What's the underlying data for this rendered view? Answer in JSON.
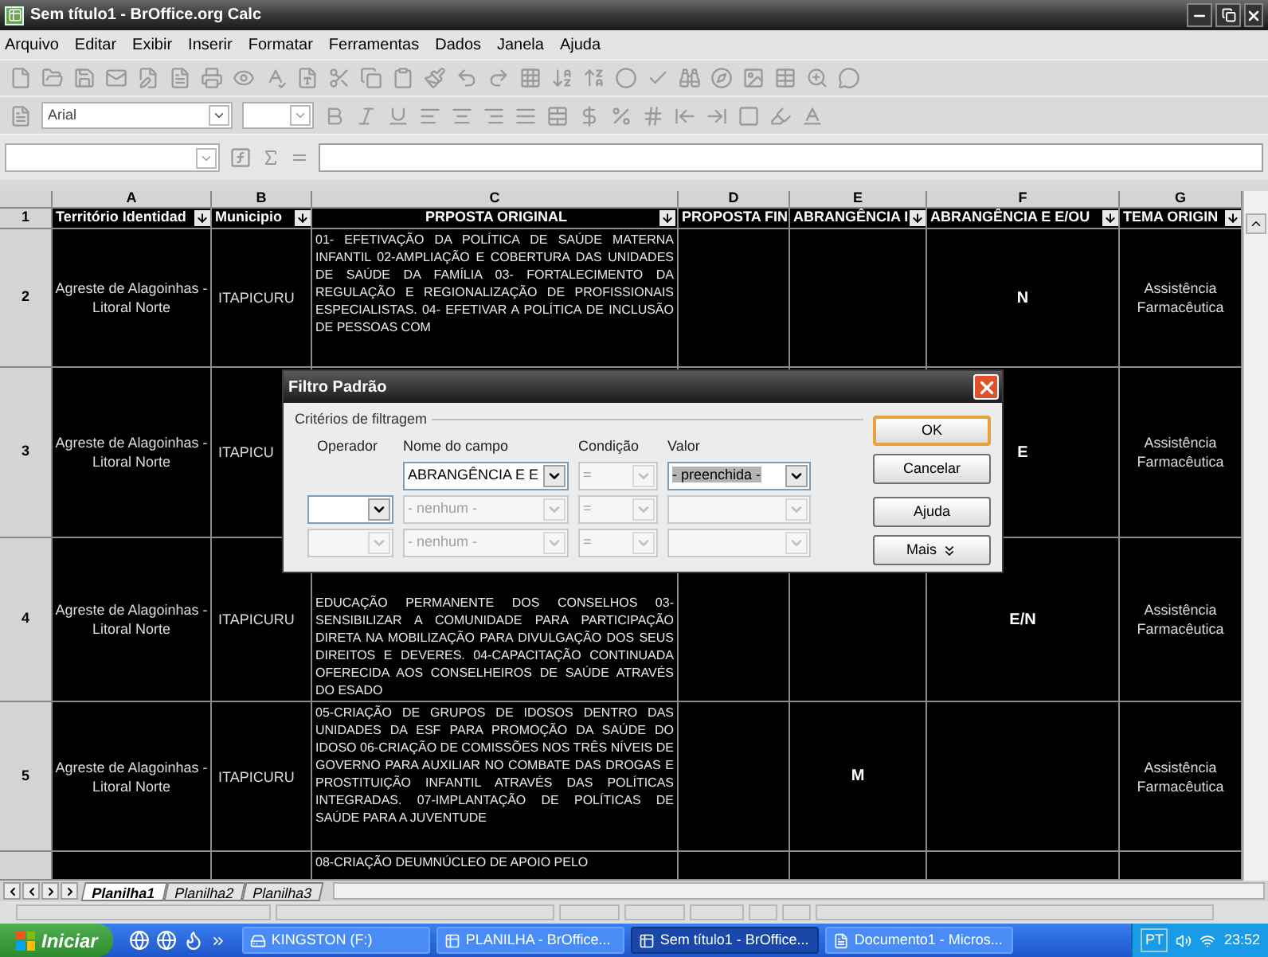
{
  "window": {
    "title": "Sem título1 - BrOffice.org Calc"
  },
  "menu": [
    "Arquivo",
    "Editar",
    "Exibir",
    "Inserir",
    "Formatar",
    "Ferramentas",
    "Dados",
    "Janela",
    "Ajuda"
  ],
  "font_name": {
    "value": "Arial"
  },
  "sheet": {
    "column_headers": [
      "A",
      "B",
      "C",
      "D",
      "E",
      "F",
      "G"
    ],
    "header_row": {
      "number": "1",
      "cells": [
        "Território Identidad",
        "Municipio",
        "PRPOSTA ORIGINAL",
        "PROPOSTA FIN",
        "ABRANGÊNCIA I",
        "ABRANGÊNCIA E E/OU",
        "TEMA ORIGIN"
      ]
    },
    "rows": [
      {
        "number": "2",
        "territory": "Agreste de Alagoinhas - Litoral Norte",
        "municipality": "ITAPICURU",
        "original_proposal": "01- EFETIVAÇÃO DA POLÍTICA DE SAÚDE MATERNA INFANTIL 02-AMPLIAÇÃO E COBERTURA DAS UNIDADES DE SAÚDE DA FAMÍLIA 03- FORTALECIMENTO DA REGULAÇÃO E REGIONALIZAÇÃO DE PROFISSIONAIS ESPECIALISTAS. 04- EFETIVAR A POLÍTICA DE INCLUSÃO DE PESSOAS COM",
        "scope_f": "N",
        "original_theme": "Assistência Farmacêutica"
      },
      {
        "number": "3",
        "territory": "Agreste de Alagoinhas - Litoral Norte",
        "municipality": "ITAPICU",
        "scope_f": "E",
        "original_theme": "Assistência Farmacêutica"
      },
      {
        "number": "4",
        "territory": "Agreste de Alagoinhas - Litoral Norte",
        "municipality": "ITAPICURU",
        "original_proposal": "EDUCAÇÃO PERMANENTE DOS CONSELHOS 03-SENSIBILIZAR A COMUNIDADE PARA PARTICIPAÇÃO DIRETA NA MOBILIZAÇÃO PARA DIVULGAÇÃO DOS SEUS DIREITOS E DEVERES. 04-CAPACITAÇÃO CONTINUADA OFERECIDA AOS CONSELHEIROS DE SAÚDE ATRAVÉS DO ESADO",
        "scope_f": "E/N",
        "original_theme": "Assistência Farmacêutica"
      },
      {
        "number": "5",
        "territory": "Agreste de Alagoinhas - Litoral Norte",
        "municipality": "ITAPICURU",
        "original_proposal": "05-CRIAÇÃO DE GRUPOS DE IDOSOS DENTRO DAS UNIDADES DA ESF PARA PROMOÇÃO DA SAÚDE DO IDOSO 06-CRIAÇÃO DE COMISSÕES NOS TRÊS NÍVEIS DE GOVERNO PARA AUXILIAR NO COMBATE DAS DROGAS E PROSTITUIÇÃO INFANTIL ATRAVÉS DAS POLÍTICAS INTEGRADAS. 07-IMPLANTAÇÃO DE POLÍTICAS DE SAÚDE PARA A JUVENTUDE",
        "scope_e": "M",
        "original_theme": "Assistência Farmacêutica"
      },
      {
        "original_proposal": "08-CRIAÇÃO DEUMNÚCLEO DE APOIO PELO"
      }
    ]
  },
  "dialog": {
    "title": "Filtro Padrão",
    "group_label": "Critérios de filtragem",
    "column_labels": [
      "Operador",
      "Nome do campo",
      "Condição",
      "Valor"
    ],
    "conditions": [
      {
        "field_name": {
          "value": "ABRANGÊNCIA E E",
          "disabled": false
        },
        "condition": {
          "value": "=",
          "disabled": true
        },
        "value": {
          "value": "- preenchida -",
          "disabled": false,
          "highlighted": true
        }
      },
      {
        "operator": {
          "disabled": false
        },
        "field_name": {
          "value": "- nenhum -",
          "disabled": true
        },
        "condition": {
          "value": "=",
          "disabled": true
        },
        "value": {
          "disabled": true
        }
      },
      {
        "operator": {
          "disabled": true
        },
        "field_name": {
          "value": "- nenhum -",
          "disabled": true
        },
        "condition": {
          "value": "=",
          "disabled": true
        },
        "value": {
          "disabled": true
        }
      }
    ],
    "buttons": [
      {
        "label": "OK",
        "kind": "default"
      },
      {
        "label": "Cancelar",
        "kind": "plain"
      },
      {
        "label": "Ajuda",
        "kind": "plain"
      },
      {
        "label": "Mais",
        "kind": "more"
      }
    ]
  },
  "sheet_tabs": [
    {
      "label": "Planilha1",
      "selected": true
    },
    {
      "label": "Planilha2",
      "selected": false
    },
    {
      "label": "Planilha3",
      "selected": false
    }
  ],
  "taskbar": {
    "start": "Iniciar",
    "tasks": [
      {
        "label": "KINGSTON (F:)",
        "selected": false
      },
      {
        "label": "PLANILHA - BrOffice...",
        "selected": false
      },
      {
        "label": "Sem título1 - BrOffice...",
        "selected": true
      },
      {
        "label": "Documento1 - Micros...",
        "selected": false
      }
    ],
    "language": "PT",
    "clock": "23:52"
  }
}
